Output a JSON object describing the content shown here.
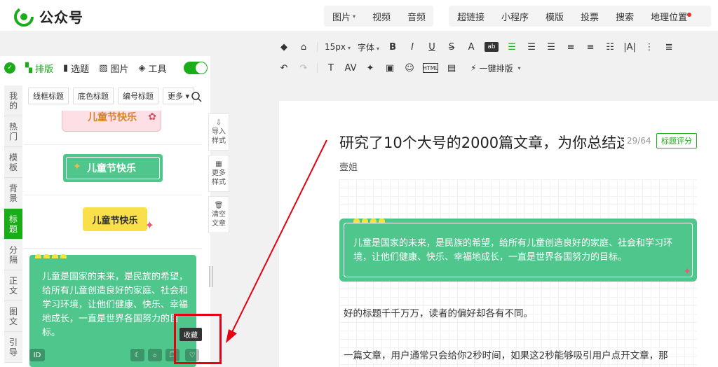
{
  "header": {
    "logo_text": "公众号",
    "menu_left": [
      "图片",
      "视频",
      "音频"
    ],
    "menu_right": [
      "超链接",
      "小程序",
      "模版",
      "投票",
      "搜索",
      "地理位置"
    ]
  },
  "toolbar": {
    "font_size": "15px",
    "font_family": "字体",
    "one_click_layout": "一键排版"
  },
  "panel": {
    "tabs": [
      "排版",
      "选题",
      "图片",
      "工具"
    ],
    "vertical_tabs": [
      "我的",
      "热门",
      "模板",
      "背景",
      "标题",
      "分隔",
      "正文",
      "图文",
      "引导"
    ],
    "filters": [
      "线框标题",
      "底色标题",
      "编号标题",
      "更多"
    ],
    "items": [
      {
        "title": "儿童节快乐"
      },
      {
        "title": "儿童节快乐"
      },
      {
        "title": "儿童节快乐"
      }
    ],
    "big_card_text": "儿童是国家的未来，是民族的希望，给所有儿童创造良好的家庭、社会和学习环境，让他们健康、快乐、幸福地成长，一直是世界各国努力的目标。",
    "card_id_label": "ID",
    "tooltip": "收藏",
    "side_tools": [
      "导入样式",
      "更多样式",
      "清空文章"
    ]
  },
  "editor": {
    "title": "研究了10个大号的2000篇文章，为你总结这",
    "title_count": "29/64",
    "title_button": "标题评分",
    "author": "壹姐",
    "card_text": "儿童是国家的未来，是民族的希望，给所有儿童创造良好的家庭、社会和学习环境，让他们健康、快乐、幸福地成长，一直是世界各国努力的目标。",
    "para1": "好的标题千千万万，读者的偏好却各有不同。",
    "para2": "一篇文章，用户通常只会给你2秒时间，如果这2秒能够吸引用户点开文章，那"
  },
  "colors": {
    "accent": "#1aad19",
    "card_green": "#4fc78c",
    "highlight_red": "#e60012"
  }
}
